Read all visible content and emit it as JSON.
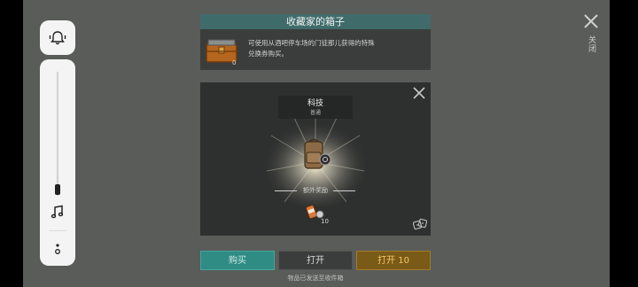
{
  "header": {
    "title": "收藏家的箱子",
    "chest_count": "0",
    "description_line1": "可使用从酒吧停车场的门徒那儿获得的特殊",
    "description_line2": "兑换券购买。"
  },
  "reward": {
    "tier_name": "科技",
    "tier_rarity": "普通",
    "bonus_label": "额外奖励",
    "bonus_count": "10"
  },
  "buttons": {
    "buy": "购买",
    "open": "打开",
    "open_prefix": "打开",
    "open_count": "10"
  },
  "footer": "物品已发送至收件箱",
  "close_label": "关闭",
  "colors": {
    "accent_teal": "#2f8c84",
    "accent_gold": "#7a5a17",
    "title_bar": "#3f6b6b"
  }
}
